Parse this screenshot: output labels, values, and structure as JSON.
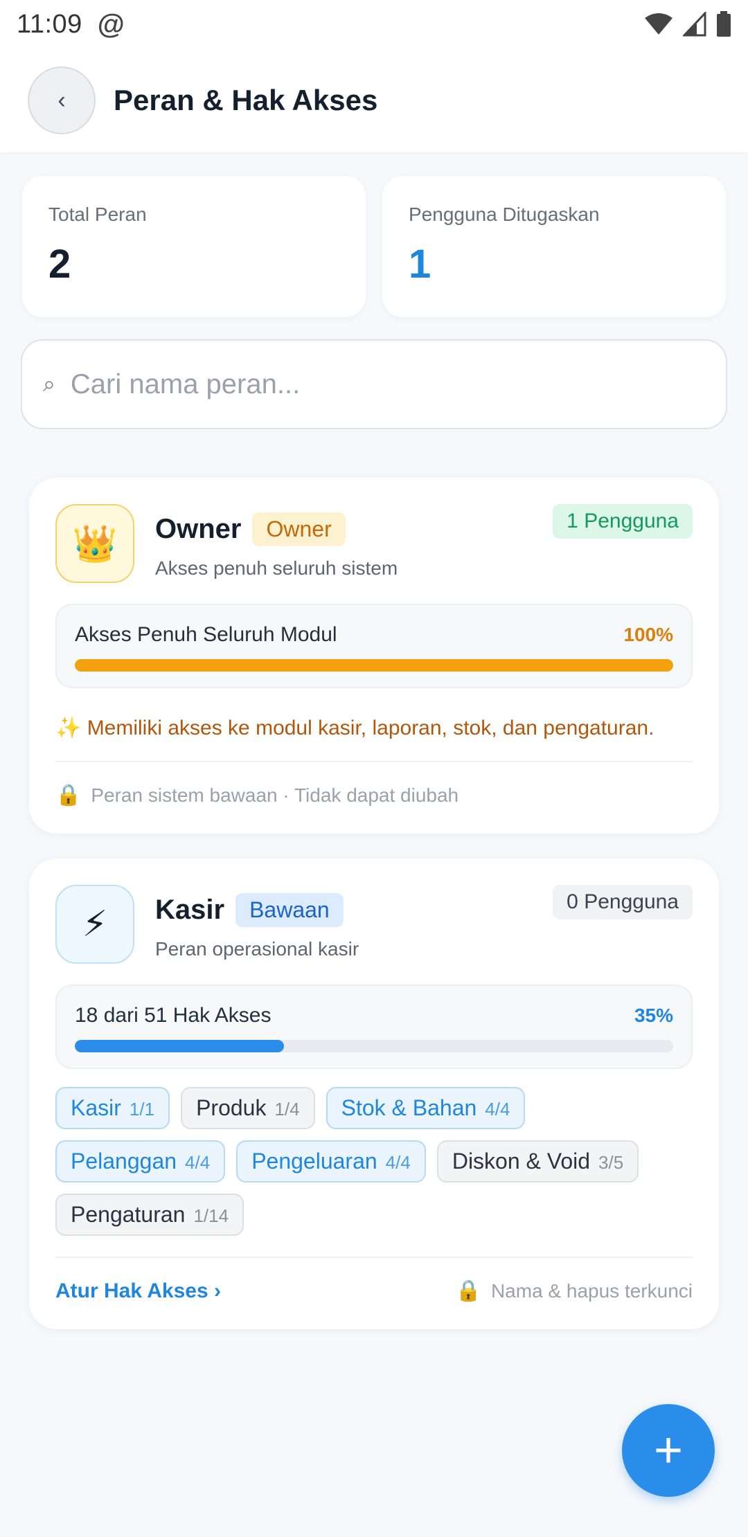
{
  "status_bar": {
    "time": "11:09"
  },
  "header": {
    "title": "Peran & Hak Akses",
    "back_glyph": "‹"
  },
  "stats": [
    {
      "label": "Total Peran",
      "value": "2",
      "color": "#15202e"
    },
    {
      "label": "Pengguna Ditugaskan",
      "value": "1",
      "color": "#1f86e0"
    }
  ],
  "search": {
    "placeholder": "Cari nama peran...",
    "value": ""
  },
  "roles": [
    {
      "name": "Owner",
      "tag": "Owner",
      "description": "Akses penuh seluruh sistem",
      "users": "1 Pengguna",
      "icon": "crown-icon",
      "access_label": "Akses Penuh Seluruh Modul",
      "access_percent_label": "100%",
      "access_fraction": 1.0,
      "note": "✨ Memiliki akses ke modul kasir, laporan, stok, dan pengaturan.",
      "footer": "Peran sistem bawaan · Tidak dapat diubah"
    },
    {
      "name": "Kasir",
      "tag": "Bawaan",
      "description": "Peran operasional kasir",
      "users": "0 Pengguna",
      "icon": "lightning-icon",
      "access_label": "18 dari 51 Hak Akses",
      "access_percent_label": "35%",
      "access_fraction": 0.35,
      "modules": [
        {
          "name": "Kasir",
          "count": "1/1",
          "style": "blue"
        },
        {
          "name": "Produk",
          "count": "1/4",
          "style": "grey"
        },
        {
          "name": "Stok & Bahan",
          "count": "4/4",
          "style": "blue"
        },
        {
          "name": "Pelanggan",
          "count": "4/4",
          "style": "blue"
        },
        {
          "name": "Pengeluaran",
          "count": "4/4",
          "style": "blue"
        },
        {
          "name": "Diskon & Void",
          "count": "3/5",
          "style": "grey"
        },
        {
          "name": "Pengaturan",
          "count": "1/14",
          "style": "grey"
        }
      ],
      "action_link": "Atur Hak Akses ›",
      "footer": "Nama & hapus terkunci"
    }
  ],
  "fab_label": "+"
}
